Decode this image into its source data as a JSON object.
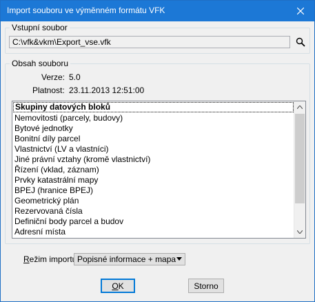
{
  "window": {
    "title": "Import souboru ve výměnném formátu VFK",
    "close_icon": "close-icon",
    "title_bar_color": "#1c78d6"
  },
  "input_group": {
    "legend": "Vstupní soubor",
    "file_path": "C:\\vfk&vkm\\Export_vse.vfk",
    "search_icon": "search-icon"
  },
  "content_group": {
    "legend": "Obsah souboru",
    "version_label": "Verze:",
    "version_value": "5.0",
    "validity_label": "Platnost:",
    "validity_value": "23.11.2013 12:51:00"
  },
  "list": {
    "items": [
      "Skupiny datových bloků",
      "Nemovitosti (parcely, budovy)",
      "Bytové jednotky",
      "Bonitní díly parcel",
      "Vlastnictví  (LV a vlastníci)",
      "Jiné právní vztahy (kromě vlastnictví)",
      "Řízení (vklad, záznam)",
      "Prvky katastrální mapy",
      "BPEJ (hranice BPEJ)",
      "Geometrický plán",
      "Rezervovaná čísla",
      "Definiční body parcel a budov",
      "Adresní místa"
    ],
    "scroll_up_icon": "chevron-up-icon",
    "scroll_down_icon": "chevron-down-icon"
  },
  "import_mode": {
    "label_accel": "R",
    "label_rest": "ežim importu:",
    "selected": "Popisné informace + mapa"
  },
  "buttons": {
    "ok_accel": "O",
    "ok_rest": "K",
    "cancel": "Storno"
  }
}
